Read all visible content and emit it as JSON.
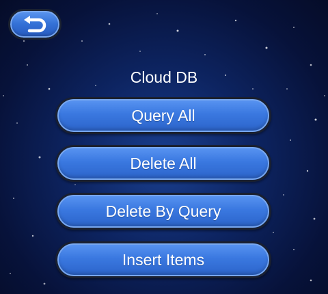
{
  "screen": {
    "title": "Cloud DB"
  },
  "back_button": {
    "icon": "return-arrow-icon"
  },
  "menu": {
    "items": [
      {
        "label": "Query All"
      },
      {
        "label": "Delete All"
      },
      {
        "label": "Delete By Query"
      },
      {
        "label": "Insert Items"
      }
    ]
  },
  "colors": {
    "background": "#0d2461",
    "button": "#3a78e0",
    "button_border": "#1a2030",
    "text": "#ffffff"
  }
}
